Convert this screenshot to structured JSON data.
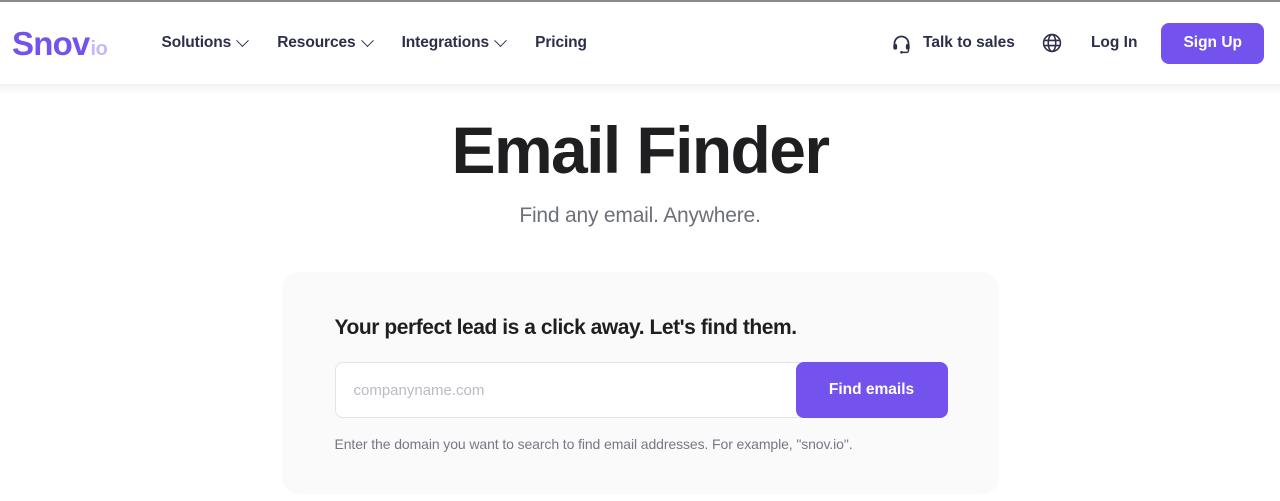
{
  "header": {
    "logo": {
      "main": "Snov",
      "suffix": "io"
    },
    "nav": [
      {
        "label": "Solutions",
        "has_dropdown": true
      },
      {
        "label": "Resources",
        "has_dropdown": true
      },
      {
        "label": "Integrations",
        "has_dropdown": true
      },
      {
        "label": "Pricing",
        "has_dropdown": false
      }
    ],
    "talk_to_sales": "Talk to sales",
    "talk_to_sales_icon": "headset-icon",
    "language_icon": "globe-icon",
    "login": "Log In",
    "signup": "Sign Up"
  },
  "hero": {
    "title": "Email Finder",
    "subtitle": "Find any email. Anywhere."
  },
  "search_card": {
    "title": "Your perfect lead is a click away. Let's find them.",
    "input_value": "",
    "input_placeholder": "companyname.com",
    "submit_label": "Find emails",
    "hint": "Enter the domain you want to search to find email addresses. For example, \"snov.io\"."
  },
  "colors": {
    "brand_purple": "#7352ed",
    "logo_suffix": "#c6b9f7",
    "nav_text": "#2d2f4a",
    "heading": "#1f1f22",
    "muted_text": "#6d6f7a",
    "card_bg": "#fafafa",
    "input_border": "#e3e4e8",
    "placeholder": "#b9bbc4"
  }
}
